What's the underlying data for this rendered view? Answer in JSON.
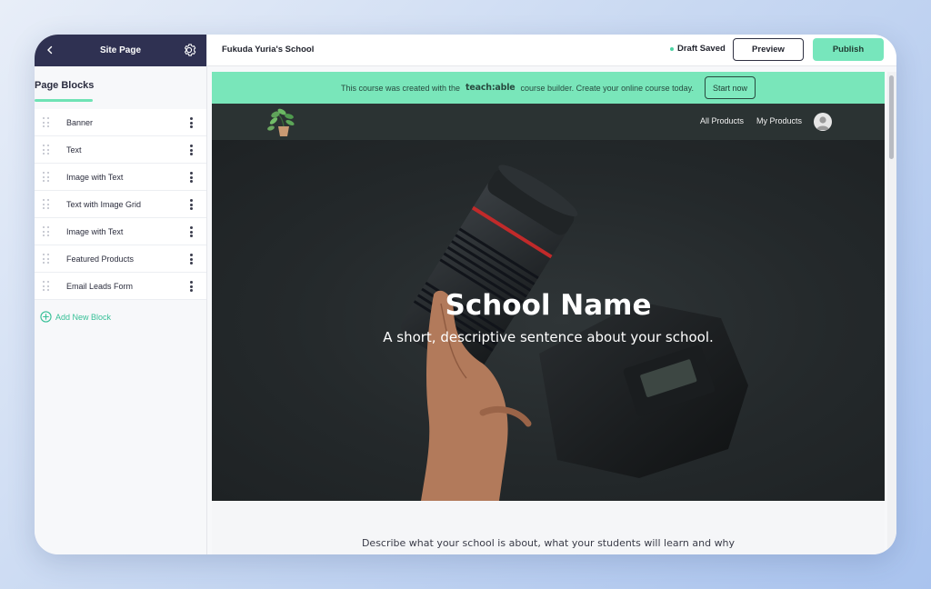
{
  "sidebar": {
    "title": "Site Page",
    "section_title": "Page Blocks",
    "blocks": [
      {
        "label": "Banner"
      },
      {
        "label": "Text"
      },
      {
        "label": "Image with Text"
      },
      {
        "label": "Text with Image Grid"
      },
      {
        "label": "Image with Text"
      },
      {
        "label": "Featured Products"
      },
      {
        "label": "Email Leads Form"
      }
    ],
    "add_block_label": "Add New Block"
  },
  "topbar": {
    "school_title": "Fukuda Yuria's School",
    "draft_status": "Draft Saved",
    "preview_label": "Preview",
    "publish_label": "Publish"
  },
  "promo": {
    "text_before": "This course was created with the",
    "brand": "teach:able",
    "text_after": "course builder. Create your online course today.",
    "cta_label": "Start now"
  },
  "site_nav": {
    "links": [
      "All Products",
      "My Products"
    ]
  },
  "hero": {
    "title": "School Name",
    "subtitle": "A short, descriptive sentence about your school."
  },
  "description": "Describe what your school is about, what your students will learn and why",
  "colors": {
    "sidebar_header": "#2f3152",
    "accent_green": "#77e6bc",
    "hero_dark": "#24292b"
  }
}
